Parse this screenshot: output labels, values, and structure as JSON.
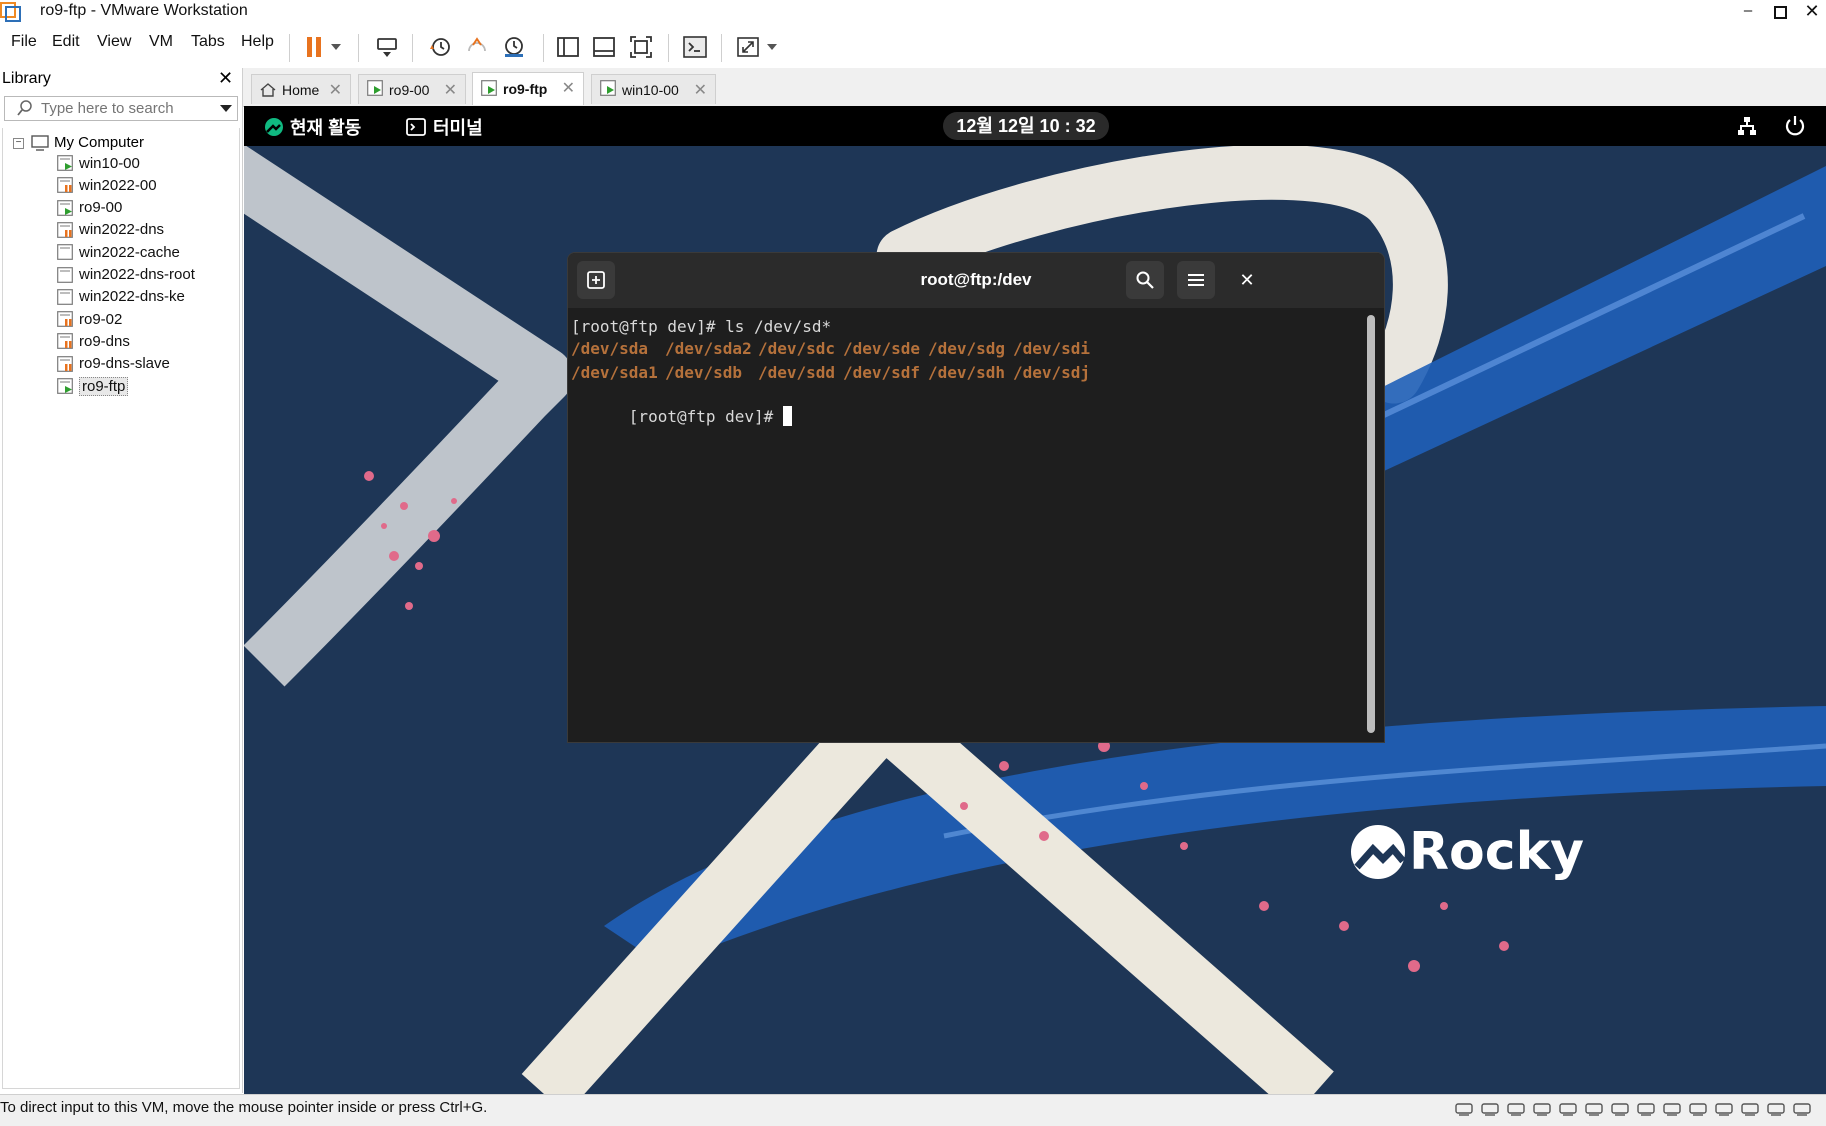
{
  "window": {
    "title": "ro9-ftp - VMware Workstation"
  },
  "menu": [
    "File",
    "Edit",
    "View",
    "VM",
    "Tabs",
    "Help"
  ],
  "library": {
    "title": "Library",
    "search_placeholder": "Type here to search",
    "root": "My Computer",
    "items": [
      {
        "label": "win10-00",
        "status": "running"
      },
      {
        "label": "win2022-00",
        "status": "paused"
      },
      {
        "label": "ro9-00",
        "status": "running"
      },
      {
        "label": "win2022-dns",
        "status": "paused"
      },
      {
        "label": "win2022-cache",
        "status": "off"
      },
      {
        "label": "win2022-dns-root",
        "status": "off"
      },
      {
        "label": "win2022-dns-ke",
        "status": "off"
      },
      {
        "label": "ro9-02",
        "status": "paused"
      },
      {
        "label": "ro9-dns",
        "status": "paused"
      },
      {
        "label": "ro9-dns-slave",
        "status": "paused"
      },
      {
        "label": "ro9-ftp",
        "status": "running",
        "selected": true
      }
    ]
  },
  "tabs": [
    {
      "label": "Home",
      "active": false
    },
    {
      "label": "ro9-00",
      "active": false
    },
    {
      "label": "ro9-ftp",
      "active": true
    },
    {
      "label": "win10-00",
      "active": false
    }
  ],
  "gnome": {
    "activities": "현재 활동",
    "app": "터미널",
    "clock": "12월 12일 10 : 32"
  },
  "terminal": {
    "title": "root@ftp:/dev",
    "command_line": "[root@ftp dev]# ls /dev/sd*",
    "devices_row1": [
      "/dev/sda",
      "/dev/sda2",
      "/dev/sdc",
      "/dev/sde",
      "/dev/sdg",
      "/dev/sdi"
    ],
    "devices_row2": [
      "/dev/sda1",
      "/dev/sdb",
      "/dev/sdd",
      "/dev/sdf",
      "/dev/sdh",
      "/dev/sdj"
    ],
    "prompt": "[root@ftp dev]# "
  },
  "wallpaper": {
    "brand": "Rocky"
  },
  "status": {
    "text": "To direct input to this VM, move the mouse pointer inside or press Ctrl+G."
  },
  "colors": {
    "desktop": "#1e3656",
    "accent_orange": "#e8731f",
    "device_text": "#b5713b",
    "running_green": "#2f9e2f"
  }
}
